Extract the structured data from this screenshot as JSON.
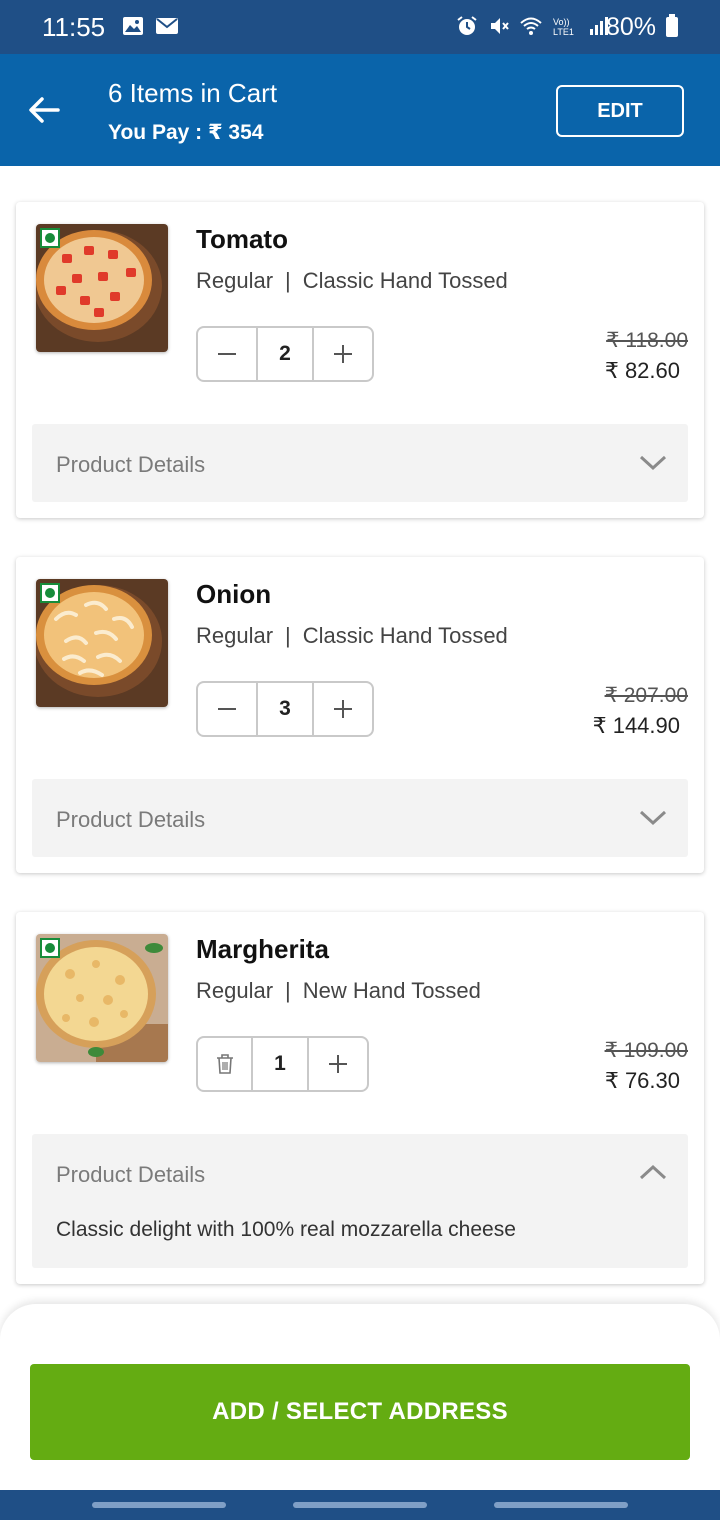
{
  "status_bar": {
    "time": "11:55",
    "battery": "80%",
    "icons": [
      "image-icon",
      "mail-icon",
      "alarm-icon",
      "mute-icon",
      "wifi-icon",
      "lte-icon",
      "signal-icon",
      "battery-icon"
    ]
  },
  "header": {
    "title": "6 Items in Cart",
    "subtitle": "You Pay : ₹ 354",
    "edit_label": "EDIT",
    "bg_color": "#0a64aa"
  },
  "items": [
    {
      "name": "Tomato",
      "size": "Regular",
      "crust": "Classic Hand Tossed",
      "quantity": "2",
      "mrp": "₹ 118.00",
      "price": "₹ 82.60",
      "details_label": "Product Details",
      "expanded": false
    },
    {
      "name": "Onion",
      "size": "Regular",
      "crust": "Classic Hand Tossed",
      "quantity": "3",
      "mrp": "₹ 207.00",
      "price": "₹ 144.90",
      "details_label": "Product Details",
      "expanded": false
    },
    {
      "name": "Margherita",
      "size": "Regular",
      "crust": "New Hand Tossed",
      "quantity": "1",
      "mrp": "₹ 109.00",
      "price": "₹ 76.30",
      "details_label": "Product Details",
      "expanded": true,
      "description": "Classic delight with 100% real mozzarella cheese"
    }
  ],
  "separator": "|",
  "cta": {
    "label": "ADD / SELECT ADDRESS",
    "color": "#64ac12"
  }
}
